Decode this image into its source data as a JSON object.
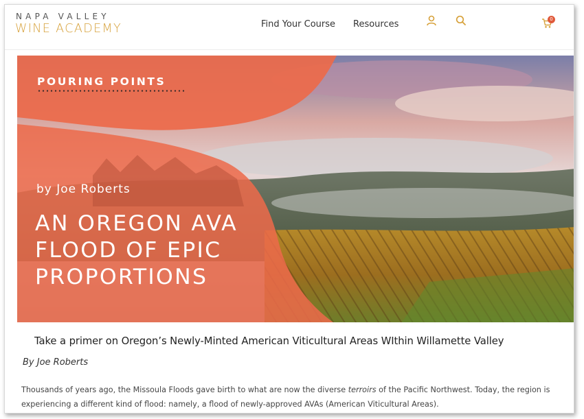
{
  "header": {
    "logo_line1": "NAPA VALLEY",
    "logo_line2": "WINE ACADEMY",
    "nav": [
      "Find Your Course",
      "Resources"
    ],
    "icons": [
      "user-icon",
      "search-icon",
      "cart-icon"
    ],
    "cart_count": "0"
  },
  "hero": {
    "kicker": "POURING POINTS",
    "byline": "by Joe Roberts",
    "title_lines": [
      "AN OREGON AVA",
      "FLOOD OF EPIC",
      "PROPORTIONS"
    ]
  },
  "article": {
    "subtitle": "Take a primer on Oregon’s Newly-Minted American Viticultural Areas WIthin Willamette Valley",
    "byline": "By Joe Roberts",
    "body_before": "Thousands of years ago, the Missoula Floods gave birth to what are now the diverse ",
    "body_em": "terroirs",
    "body_after": " of the Pacific Northwest. Today, the region is experiencing a different kind of flood: namely, a flood of newly-approved AVAs (American Viticultural Areas)."
  },
  "colors": {
    "accent_gold": "#d7a23c",
    "hero_overlay": "#ec6a4a",
    "cart_badge": "#e05a3b"
  }
}
